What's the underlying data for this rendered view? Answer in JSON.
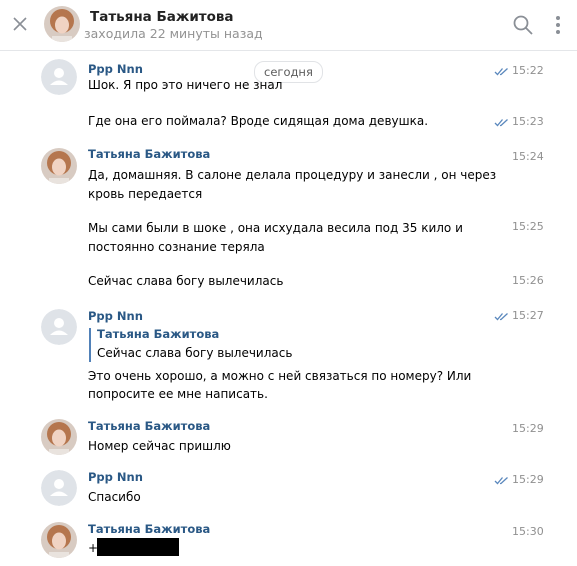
{
  "header": {
    "title": "Татьяна Бажитова",
    "status": "заходила 22 минуты назад"
  },
  "date_separator": "сегодня",
  "colors": {
    "link": "#2a5885",
    "accent": "#5181b8",
    "read_check": "#5b88bd"
  },
  "messages": [
    {
      "sender": "Ppp Nnn",
      "time": "15:22",
      "lines": [
        "Шок. Я про это ничего не знал"
      ],
      "status": "read"
    },
    {
      "sender": "",
      "time": "15:23",
      "lines": [
        "Где она его поймала? Вроде сидящая дома девушка."
      ],
      "status": "read"
    },
    {
      "sender": "Татьяна Бажитова",
      "time": "15:24",
      "lines": [
        "Да, домашняя. В салоне делала процедуру и занесли , он через",
        "кровь передается"
      ]
    },
    {
      "sender": "",
      "time": "15:25",
      "lines": [
        "Мы сами были в шоке , она исхудала весила под 35 кило и",
        "постоянно сознание теряла"
      ]
    },
    {
      "sender": "",
      "time": "15:26",
      "lines": [
        "Сейчас слава богу вылечилась"
      ]
    },
    {
      "sender": "Ppp Nnn",
      "time": "15:27",
      "status": "read",
      "quote": {
        "author": "Татьяна Бажитова",
        "text": "Сейчас слава богу вылечилась"
      },
      "lines": [
        "Это очень хорошо, а можно с ней связаться по номеру? Или",
        "попросите ее мне написать."
      ]
    },
    {
      "sender": "Татьяна Бажитова",
      "time": "15:29",
      "lines": [
        "Номер сейчас пришлю"
      ]
    },
    {
      "sender": "Ppp Nnn",
      "time": "15:29",
      "lines": [
        "Спасибо"
      ],
      "status": "read"
    },
    {
      "sender": "Татьяна Бажитова",
      "time": "15:30",
      "lines": [
        "+"
      ]
    }
  ]
}
